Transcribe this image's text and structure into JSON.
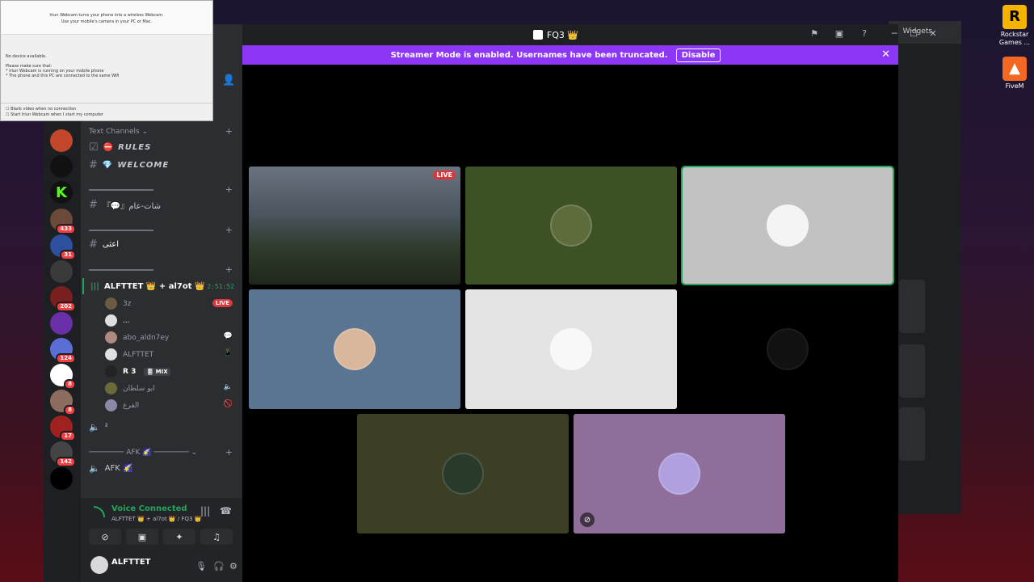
{
  "desktop": {
    "icons": [
      {
        "label": "Rockstar Games ...",
        "glyph": "R"
      },
      {
        "label": "FiveM",
        "glyph": "▲"
      }
    ]
  },
  "bg_app": {
    "widgets_label": "Widgets"
  },
  "window": {
    "title": "FQ3 👑"
  },
  "streamer_banner": {
    "text": "Streamer Mode is enabled. Usernames have been truncated.",
    "button": "Disable"
  },
  "servers": [
    {
      "badge": ""
    },
    {
      "badge": ""
    },
    {
      "badge": ""
    },
    {
      "badge": "433"
    },
    {
      "badge": "31"
    },
    {
      "badge": ""
    },
    {
      "badge": "202"
    },
    {
      "badge": ""
    },
    {
      "badge": "124"
    },
    {
      "badge": "8"
    },
    {
      "badge": "8"
    },
    {
      "badge": "17"
    },
    {
      "badge": "142"
    },
    {
      "badge": ""
    }
  ],
  "channels": {
    "text_category": "Text Channels",
    "rules": "RULES",
    "welcome": "WELCOME",
    "chat1": "『💬』شات-عام",
    "chat2": "اعثى",
    "voice_channel": "ALFTTET 👑 + al7ot 👑",
    "voice_timer": "2:51:52",
    "voice_users": [
      {
        "name": "3z",
        "extra": "LIVE"
      },
      {
        "name": "...",
        "extra": ""
      },
      {
        "name": "abo_aldn7ey",
        "extra": "💬"
      },
      {
        "name": "ALFTTET",
        "extra": "📱"
      },
      {
        "name": "R 3",
        "extra": "🎚 MIX"
      },
      {
        "name": "ابو سلطان",
        "extra": "🔈"
      },
      {
        "name": "الفرع",
        "extra": "🚫"
      }
    ],
    "voice2_count": "²",
    "afk_category": "AFK 🌠",
    "afk_channel": "AFK 🌠"
  },
  "voice_panel": {
    "status": "Voice Connected",
    "sub": "ALFTTET 👑 + al7ot 👑 / FQ3 👑"
  },
  "user_panel": {
    "name": "ALFTTET"
  },
  "stage": {
    "live_label": "LIVE"
  },
  "popup": {
    "line1": "Iriun Webcam turns your phone into a wireless Webcam.",
    "line2": "Use your mobile's camera in your PC or Mac.",
    "body1": "No device available.",
    "body2": "Please make sure that:",
    "body3": "* Iriun Webcam is running on your mobile phone",
    "body4": "* The phone and this PC are connected to the same Wifi",
    "opt1": "Blank video when no connection",
    "opt2": "Start Iriun Webcam when I start my computer"
  },
  "colors": {
    "accent": "#8c37f5",
    "online": "#23a55a",
    "live": "#da373c"
  }
}
